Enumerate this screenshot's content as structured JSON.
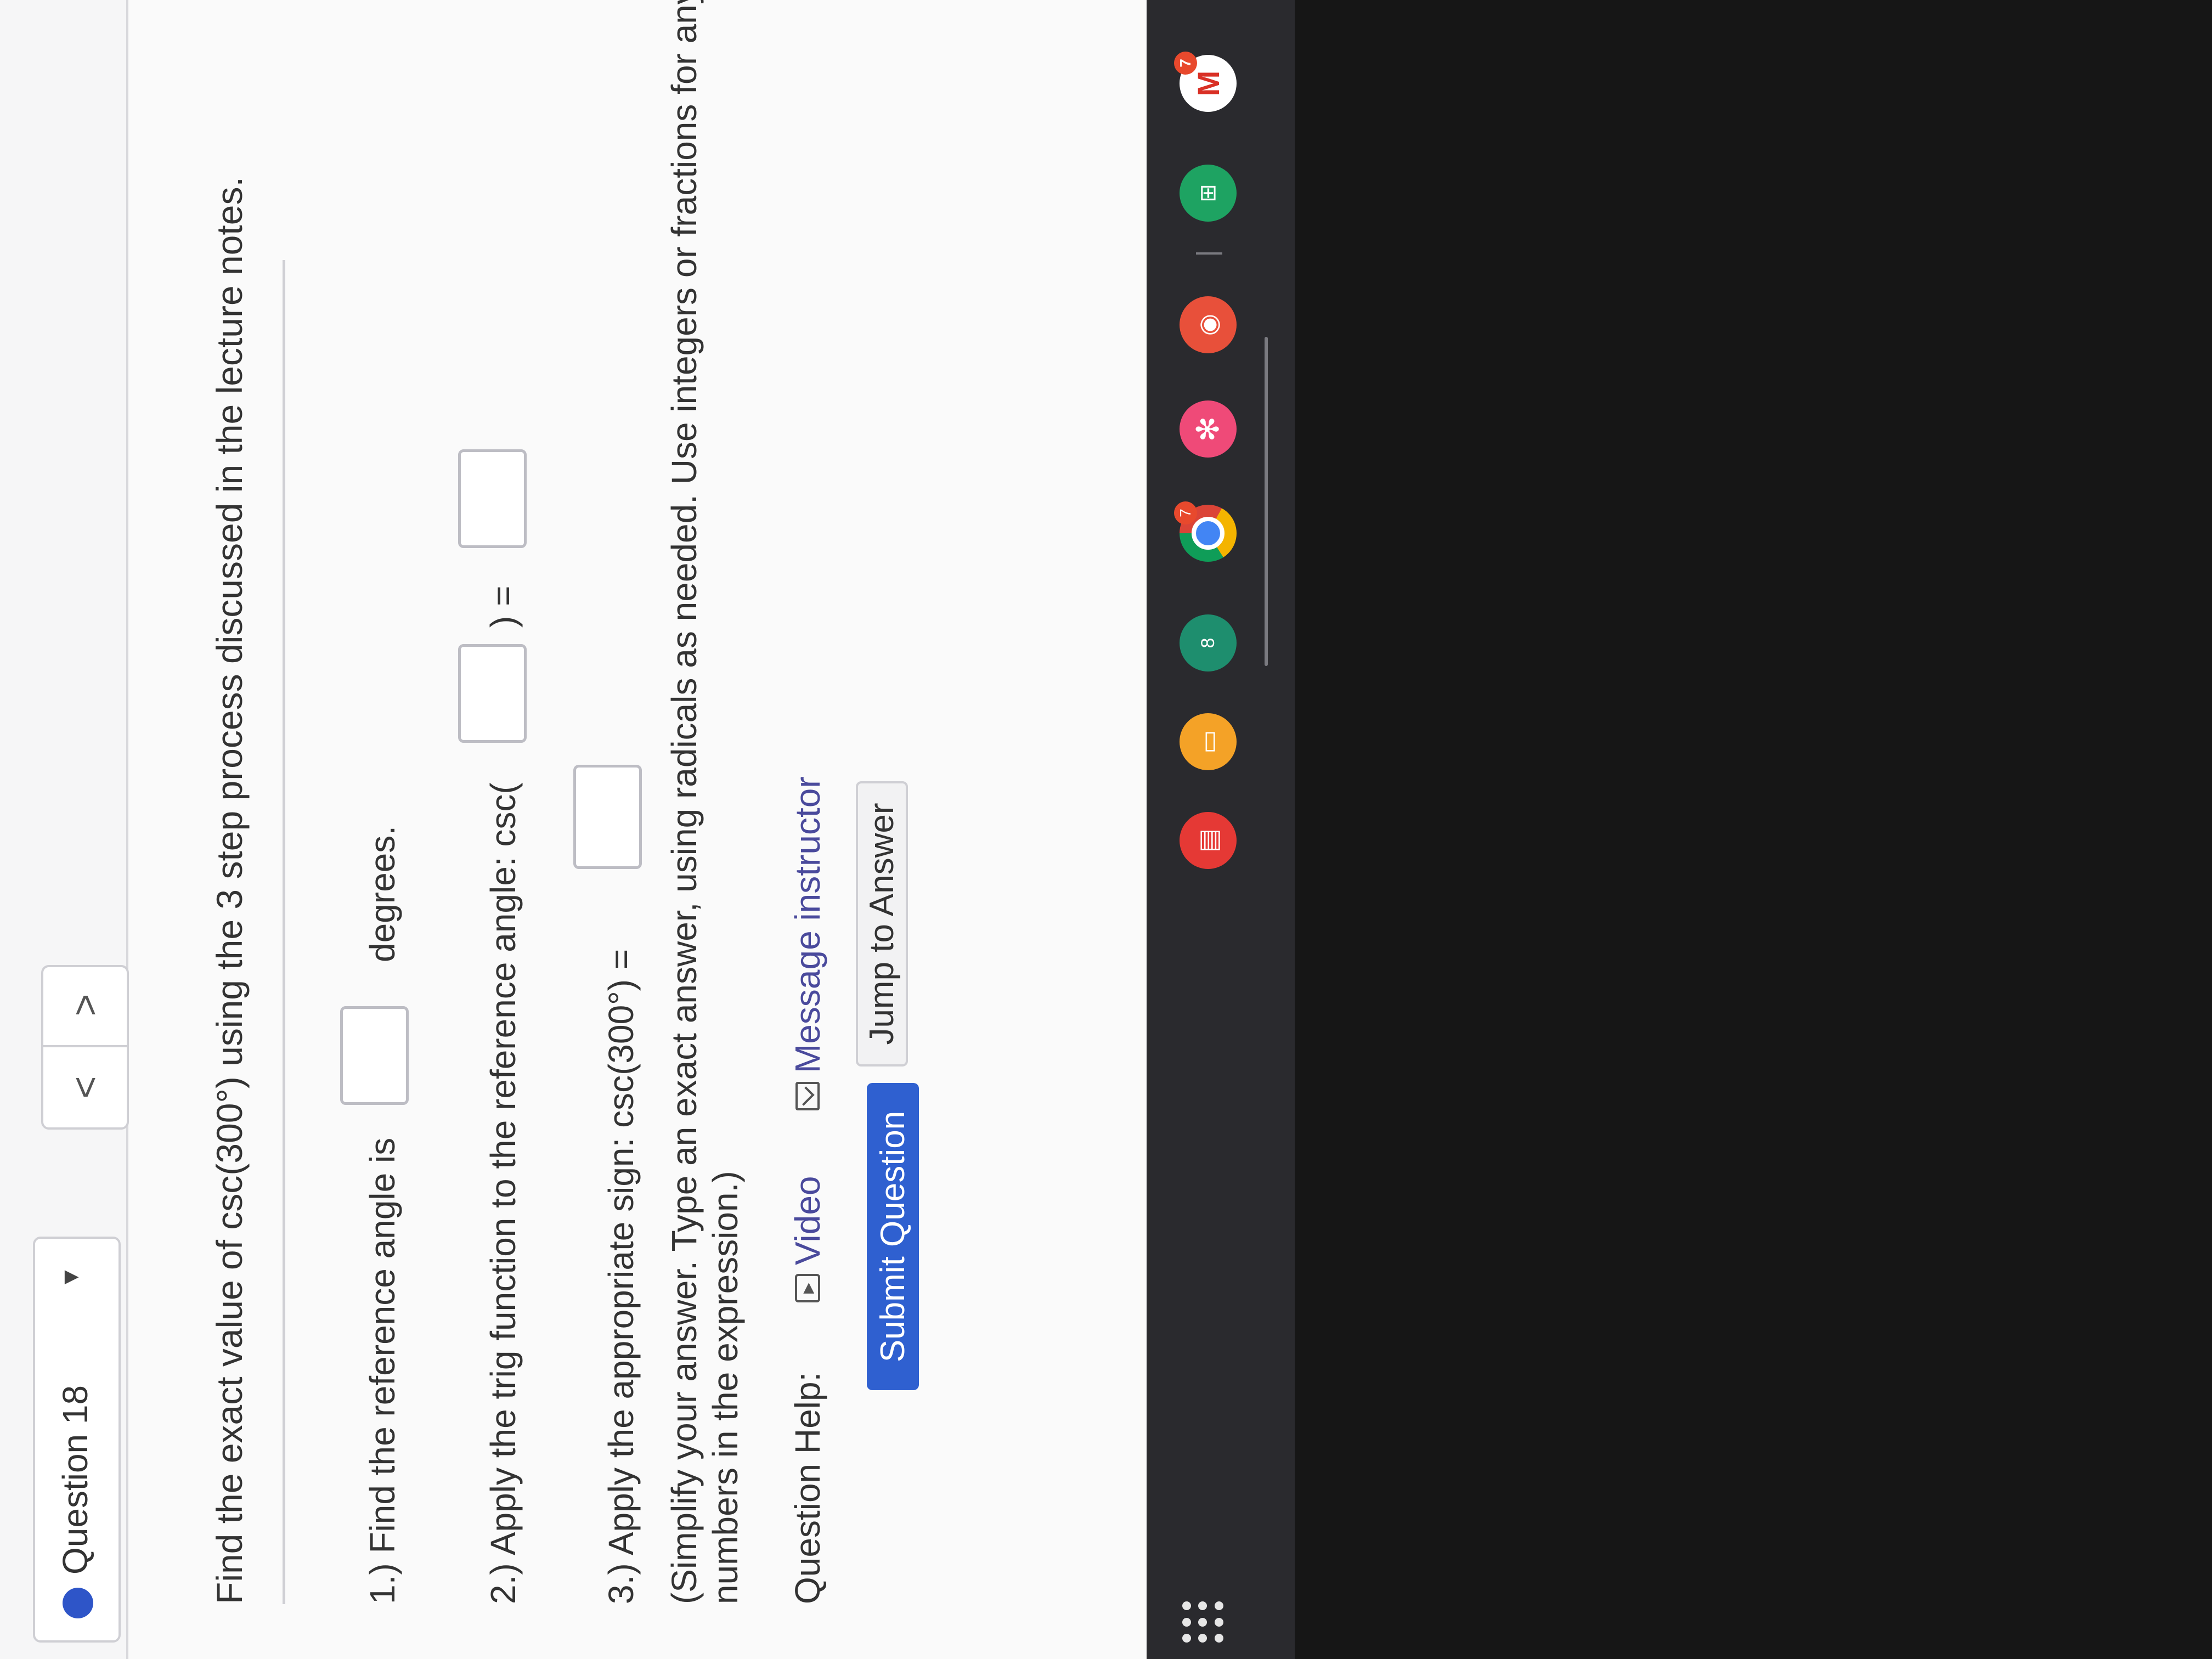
{
  "header": {
    "question_title": "Question 18",
    "caret": "▼",
    "prev": "<",
    "next": ">"
  },
  "prompt": "Find the exact value of csc(300°) using the 3 step process discussed in the lecture notes.",
  "steps": {
    "step1": {
      "label": "1.) Find the reference angle is",
      "unit": "degrees."
    },
    "step2": {
      "label": "2.) Apply the trig function to the reference angle: csc(",
      "mid": ") ="
    },
    "step3": {
      "label": "3.) Apply the appropriate sign: csc(300°) =",
      "note_line1": "(Simplify your answer. Type an exact answer, using radicals as needed. Use integers or fractions for any",
      "note_line2": "numbers in the expression.)"
    }
  },
  "help": {
    "label": "Question Help:",
    "video": "Video",
    "message": "Message instructor"
  },
  "actions": {
    "submit": "Submit Question",
    "jump": "Jump to Answer"
  },
  "shelf": {
    "apps": [
      {
        "name": "slides",
        "color": "#e53935"
      },
      {
        "name": "keep",
        "color": "#f4a227"
      },
      {
        "name": "classroom",
        "color": "#1e8e6e",
        "glyph": "8"
      },
      {
        "name": "chrome",
        "badge": "7"
      },
      {
        "name": "photos",
        "color": "#ef4a78",
        "glyph": "✻"
      },
      {
        "name": "camera",
        "color": "#e8503a"
      },
      {
        "name": "sheets",
        "color": "#1ea362",
        "glyph": "⊞"
      },
      {
        "name": "gmail",
        "glyph": "M",
        "badge": "7"
      }
    ]
  }
}
